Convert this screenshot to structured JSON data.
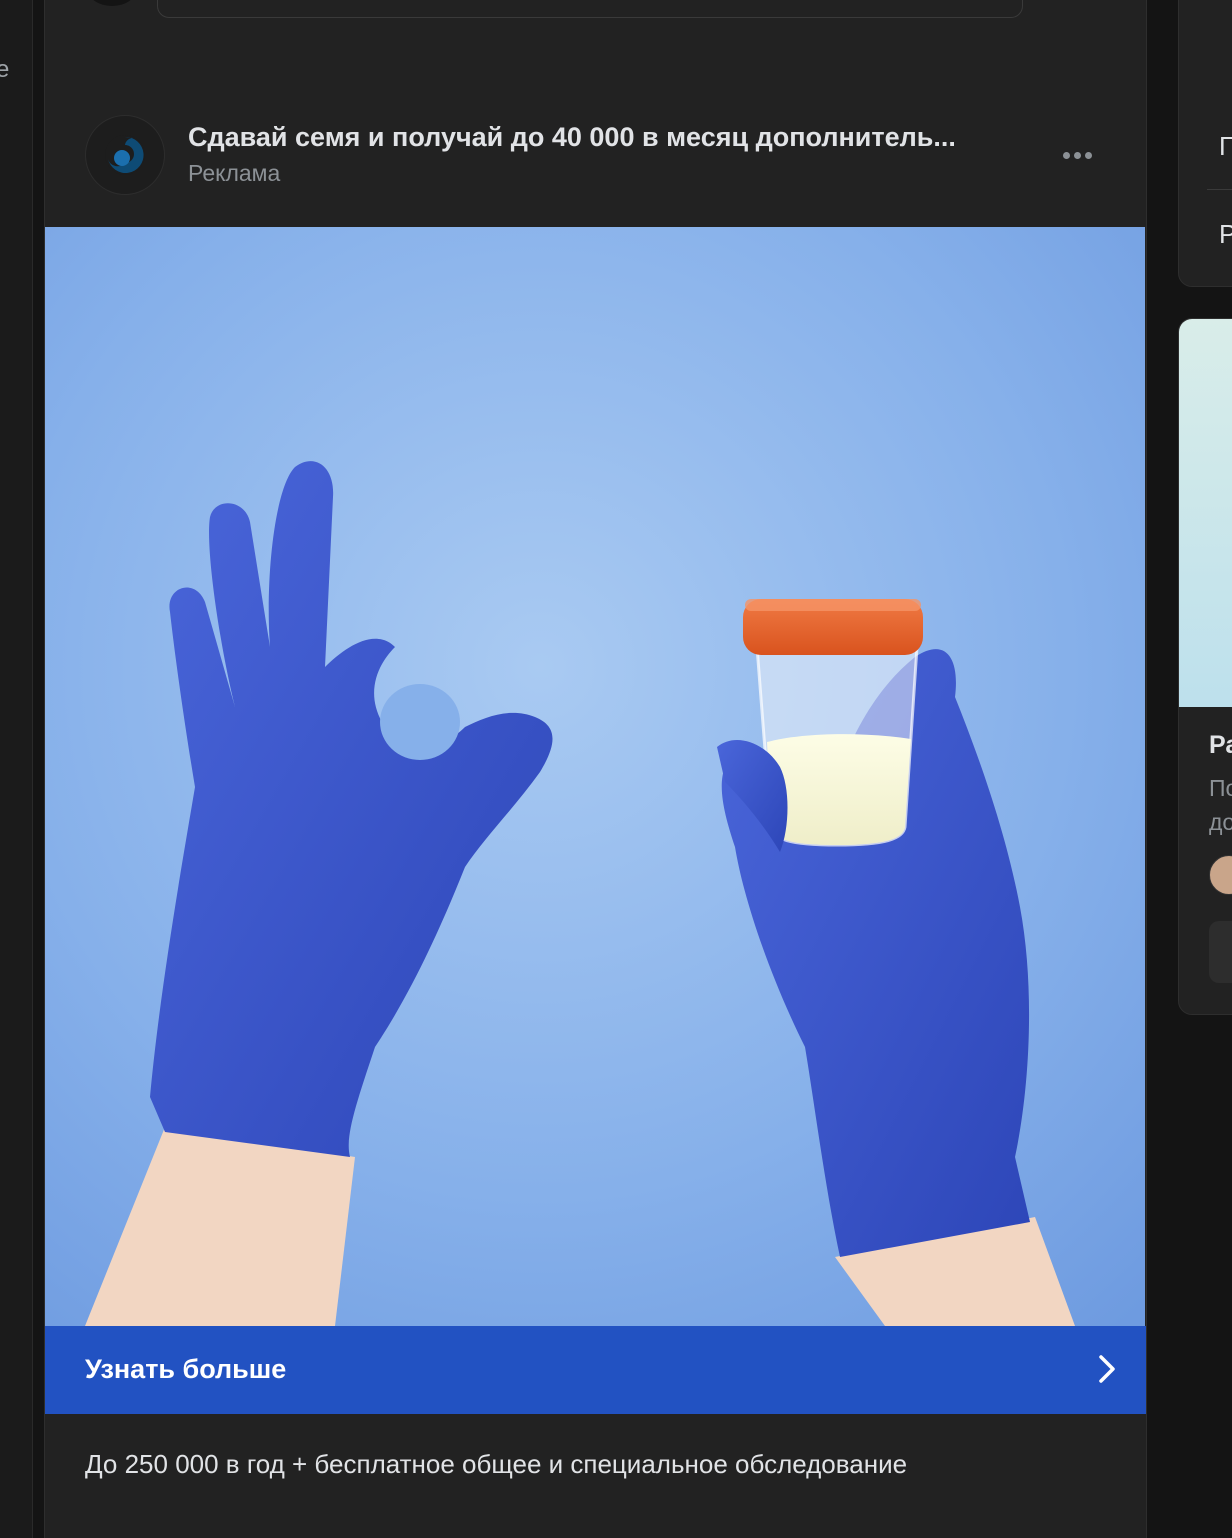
{
  "left_rail": {
    "fragment": "e"
  },
  "post": {
    "title": "Сдавай семя и получай до 40 000 в месяц дополнитель...",
    "subtitle": "Реклама",
    "image_alt": "Руки в синих перчатках: жест «ОК» и контейнер с образцом",
    "cta_label": "Узнать больше",
    "description": "До 250 000 в год + бесплатное общее и специальное обследование"
  },
  "right_column": {
    "card_top": {
      "line1": "П",
      "line2": "Р"
    },
    "card_ad": {
      "title_fragment": "Ра",
      "desc_fragment_1": "По",
      "desc_fragment_2": "до"
    }
  },
  "icons": {
    "publisher_logo": "swirl-logo-icon",
    "more": "more-dots-icon",
    "cta_arrow": "chevron-right-icon"
  },
  "colors": {
    "background": "#141414",
    "card": "#222222",
    "cta": "#2252c2",
    "text_primary": "#e1e3e6",
    "text_secondary": "#8c9196",
    "glove_blue": "#3a55cc",
    "backdrop_blue": "#7ea8e6"
  }
}
